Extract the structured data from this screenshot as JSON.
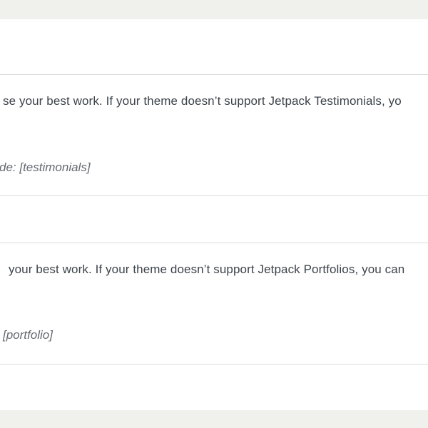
{
  "testimonials": {
    "description": "se your best work. If your theme doesn’t support Jetpack Testimonials, yo",
    "shortcode": "de: [testimonials]"
  },
  "portfolios": {
    "description": "your best work. If your theme doesn’t support Jetpack Portfolios, you can",
    "shortcode": "[portfolio]"
  }
}
